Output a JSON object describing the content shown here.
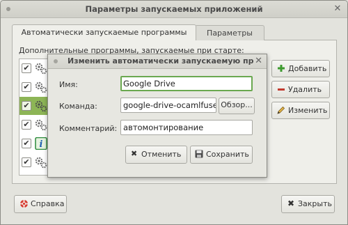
{
  "window": {
    "title": "Параметры запускаемых приложений"
  },
  "tabs": [
    {
      "label": "Автоматически запускаемые программы",
      "active": true
    },
    {
      "label": "Параметры",
      "active": false
    }
  ],
  "list": {
    "label": "Дополнительные программы, запускаемые при старте:",
    "rows": [
      {
        "checked": true,
        "icon": "gears-icon",
        "selected": false
      },
      {
        "checked": true,
        "icon": "gears-icon",
        "selected": false
      },
      {
        "checked": true,
        "icon": "gears-icon",
        "selected": true
      },
      {
        "checked": true,
        "icon": "gears-icon",
        "selected": false
      },
      {
        "checked": true,
        "icon": "info-icon",
        "selected": false
      },
      {
        "checked": true,
        "icon": "gears-icon",
        "selected": false
      }
    ]
  },
  "side_buttons": {
    "add": "Добавить",
    "remove": "Удалить",
    "edit": "Изменить"
  },
  "bottom": {
    "help": "Справка",
    "close": "Закрыть"
  },
  "dialog": {
    "title": "Изменить автоматически запускаемую пр",
    "name_label": "Имя:",
    "name_value": "Google Drive",
    "command_label": "Команда:",
    "command_value": "google-drive-ocamlfuse",
    "browse": "Обзор...",
    "comment_label": "Комментарий:",
    "comment_value": "автомонтирование",
    "cancel": "Отменить",
    "save": "Сохранить"
  },
  "colors": {
    "selection": "#8db556",
    "focus_border": "#6aa84f",
    "check": "#2e6b2a",
    "info": "#2a8a3a"
  }
}
